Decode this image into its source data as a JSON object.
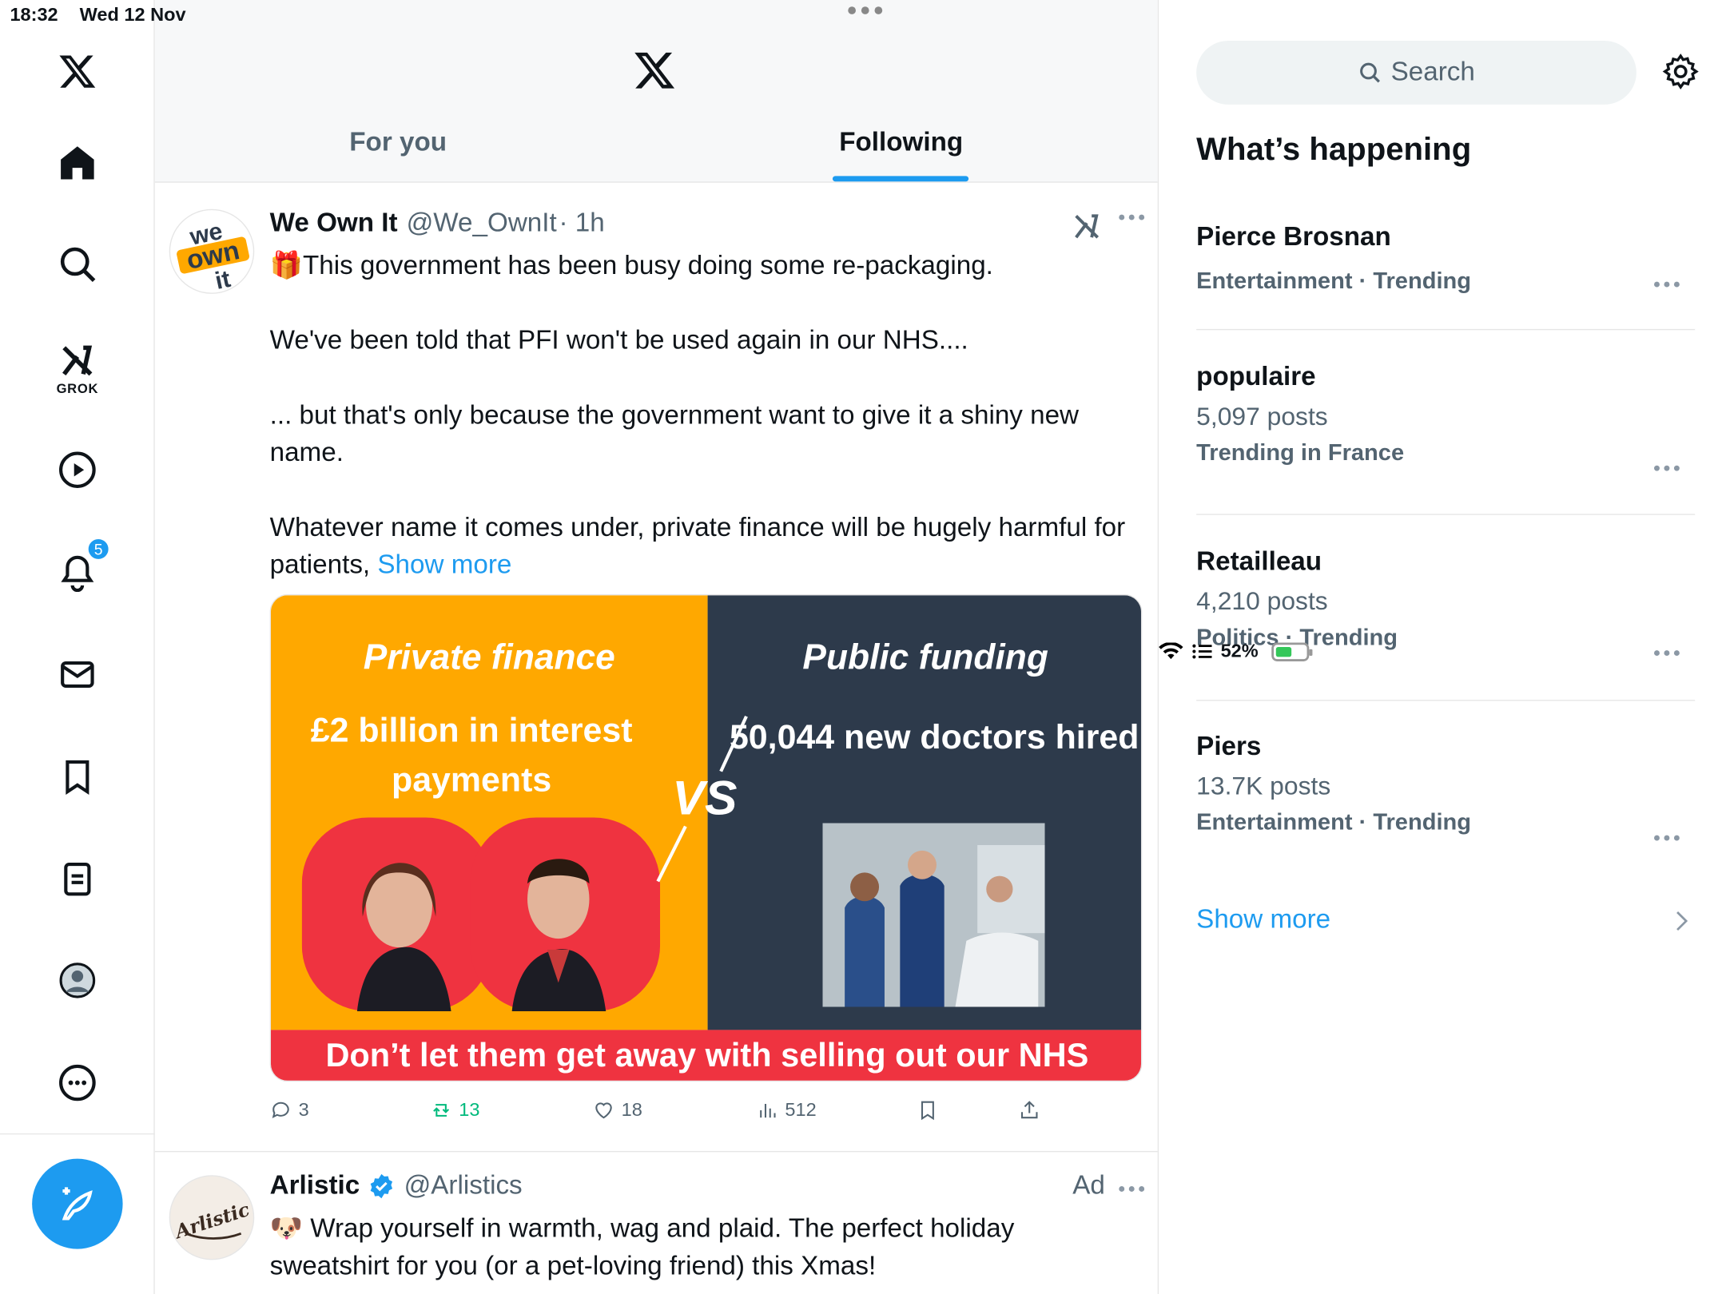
{
  "status": {
    "time": "18:32",
    "date": "Wed 12 Nov",
    "battery": "52%",
    "battery_level": 0.52
  },
  "sidebar": {
    "grok_label": "GROK",
    "notifications_badge": "5"
  },
  "header": {
    "tabs": [
      {
        "label": "For you"
      },
      {
        "label": "Following"
      }
    ],
    "active_tab": "Following"
  },
  "posts": [
    {
      "author": "We Own It",
      "handle": "@We_OwnIt",
      "time": "· 1h",
      "avatar_text": "we own it",
      "body": "🎁This government has been busy doing some re-packaging.\n\nWe've been told that PFI won't be used again in our NHS....\n\n... but that's only because the government want to give it a shiny new name.\n\nWhatever name it comes under, private finance will be hugely harmful for patients, ",
      "show_more": "Show more",
      "media": {
        "left_title": "Private finance",
        "left_sub": "£2 billion in interest payments",
        "vs": "VS",
        "right_title": "Public funding",
        "right_sub": "50,044 new doctors hired",
        "banner": "Don’t let them get away with selling out our NHS"
      },
      "stats": {
        "replies": "3",
        "reposts": "13",
        "likes": "18",
        "views": "512"
      }
    },
    {
      "author": "Arlistic",
      "handle": "@Arlistics",
      "ad_label": "Ad",
      "avatar_text": "Arlistic",
      "body": "🐶 Wrap yourself in warmth, wag and plaid. The perfect holiday sweatshirt for you (or a pet-loving friend) this Xmas!"
    }
  ],
  "right": {
    "search_placeholder": "Search",
    "whats_happening": "What’s happening",
    "trends": [
      {
        "name": "Pierce Brosnan",
        "count": "",
        "meta": "Entertainment · Trending"
      },
      {
        "name": "populaire",
        "count": "5,097 posts",
        "meta": "Trending in France"
      },
      {
        "name": "Retailleau",
        "count": "4,210 posts",
        "meta": "Politics · Trending"
      },
      {
        "name": "Piers",
        "count": "13.7K posts",
        "meta": "Entertainment · Trending"
      }
    ],
    "show_more": "Show more"
  },
  "colors": {
    "accent": "#1d9bf0",
    "repost": "#00ba7c",
    "orange": "#ffa800",
    "navy": "#2d3a4b",
    "red": "#ef3340"
  }
}
